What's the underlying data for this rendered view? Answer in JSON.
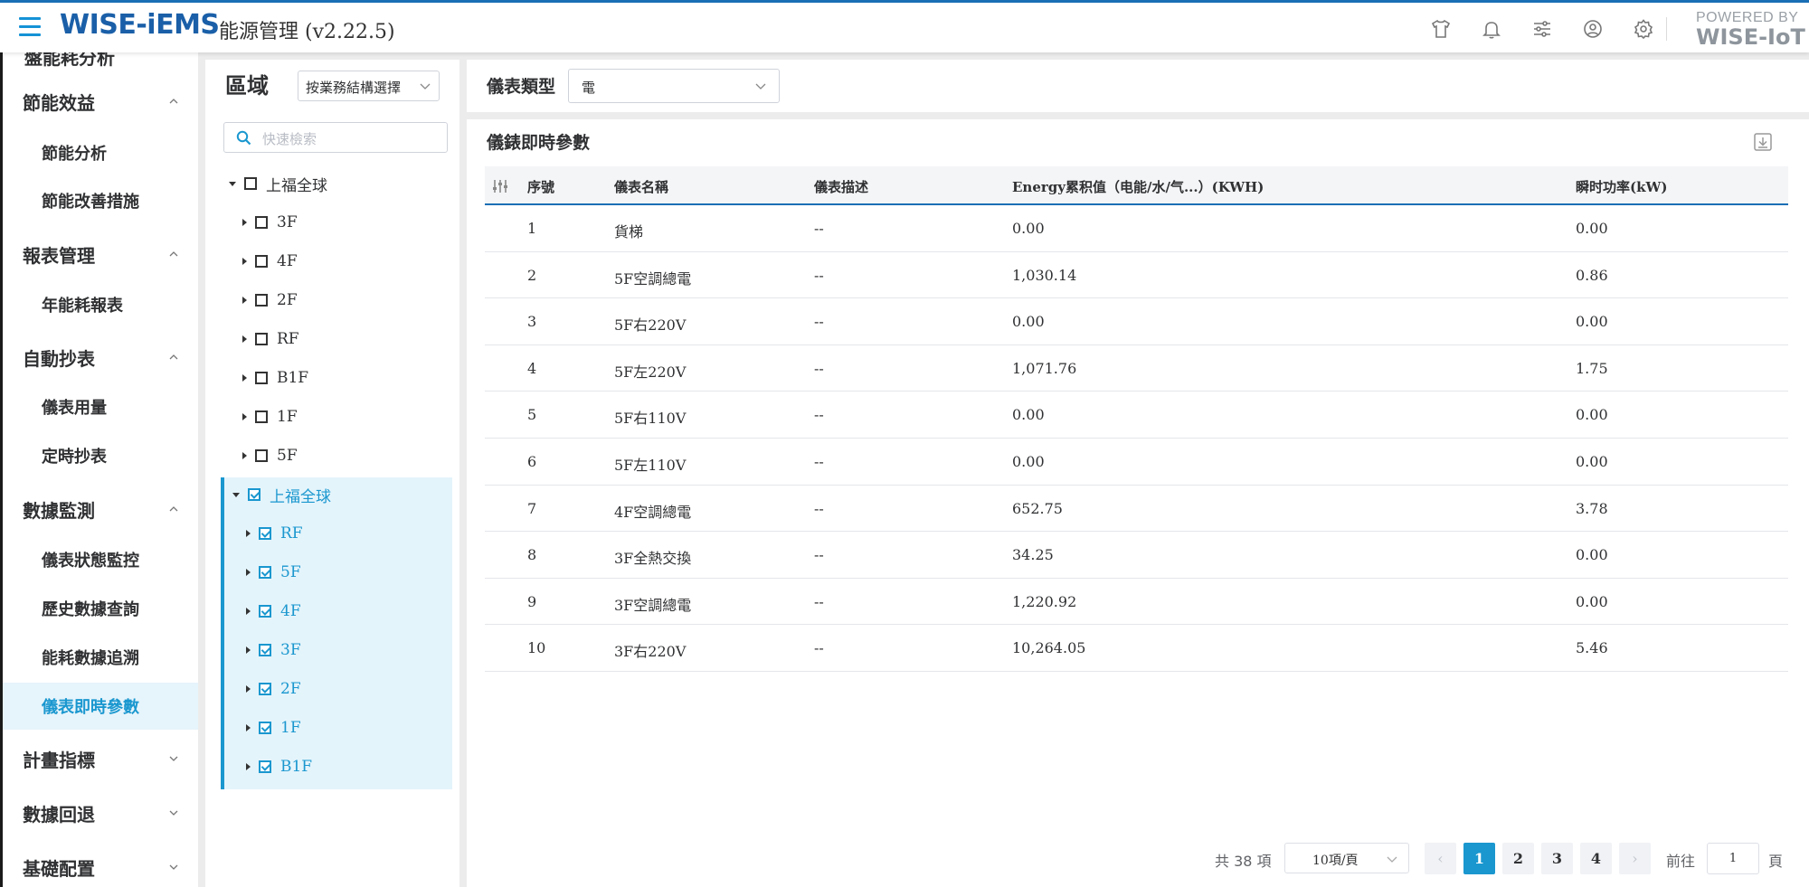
{
  "header": {
    "logo": "WISE-iEMS",
    "title": "能源管理 (v2.22.5)",
    "powered_by_line1": "POWERED BY",
    "powered_by_line2": "WISE-IoT",
    "icons": [
      "shirt-icon",
      "bell-icon",
      "sliders-icon",
      "user-circle-icon",
      "gear-icon"
    ]
  },
  "sidebar": {
    "cut_off_label": "盤能耗分析",
    "groups": [
      {
        "label": "節能效益",
        "expanded": true,
        "items": [
          "節能分析",
          "節能改善措施"
        ]
      },
      {
        "label": "報表管理",
        "expanded": true,
        "items": [
          "年能耗報表"
        ]
      },
      {
        "label": "自動抄表",
        "expanded": true,
        "items": [
          "儀表用量",
          "定時抄表"
        ]
      },
      {
        "label": "數據監測",
        "expanded": true,
        "items": [
          "儀表狀態監控",
          "歷史數據查詢",
          "能耗數據追溯",
          "儀表即時參數"
        ]
      },
      {
        "label": "計畫指標",
        "expanded": false,
        "items": []
      },
      {
        "label": "數據回退",
        "expanded": false,
        "items": []
      },
      {
        "label": "基礎配置",
        "expanded": false,
        "items": []
      }
    ],
    "active_item": "儀表即時參數"
  },
  "region": {
    "title": "區域",
    "org_select": "按業務結構選擇",
    "search_placeholder": "快速檢索",
    "tree1": {
      "root": "上福全球",
      "children": [
        "3F",
        "4F",
        "2F",
        "RF",
        "B1F",
        "1F",
        "5F"
      ]
    },
    "tree2": {
      "root": "上福全球",
      "children": [
        "RF",
        "5F",
        "4F",
        "3F",
        "2F",
        "1F",
        "B1F"
      ]
    }
  },
  "filter": {
    "label": "儀表類型",
    "value": "電"
  },
  "card": {
    "title": "儀錶即時參數"
  },
  "table": {
    "headers": [
      "序號",
      "儀表名稱",
      "儀表描述",
      "Energy累积值（电能/水/气...）(KWH)",
      "瞬时功率(kW)"
    ],
    "rows": [
      [
        "1",
        "貨梯",
        "--",
        "0.00",
        "0.00"
      ],
      [
        "2",
        "5F空調總電",
        "--",
        "1,030.14",
        "0.86"
      ],
      [
        "3",
        "5F右220V",
        "--",
        "0.00",
        "0.00"
      ],
      [
        "4",
        "5F左220V",
        "--",
        "1,071.76",
        "1.75"
      ],
      [
        "5",
        "5F右110V",
        "--",
        "0.00",
        "0.00"
      ],
      [
        "6",
        "5F左110V",
        "--",
        "0.00",
        "0.00"
      ],
      [
        "7",
        "4F空調總電",
        "--",
        "652.75",
        "3.78"
      ],
      [
        "8",
        "3F全熱交換",
        "--",
        "34.25",
        "0.00"
      ],
      [
        "9",
        "3F空調總電",
        "--",
        "1,220.92",
        "0.00"
      ],
      [
        "10",
        "3F右220V",
        "--",
        "10,264.05",
        "5.46"
      ]
    ]
  },
  "pagination": {
    "total": "共 38 項",
    "page_size": "10項/頁",
    "pages": [
      "1",
      "2",
      "3",
      "4"
    ],
    "current": "1",
    "goto_label": "前往",
    "goto_value": "1",
    "page_suffix": "頁",
    "prev": "‹",
    "next": "›"
  },
  "colors": {
    "accent": "#1a97cf",
    "brand": "#1a5fa8",
    "selected_bg": "#e4f4fb"
  }
}
